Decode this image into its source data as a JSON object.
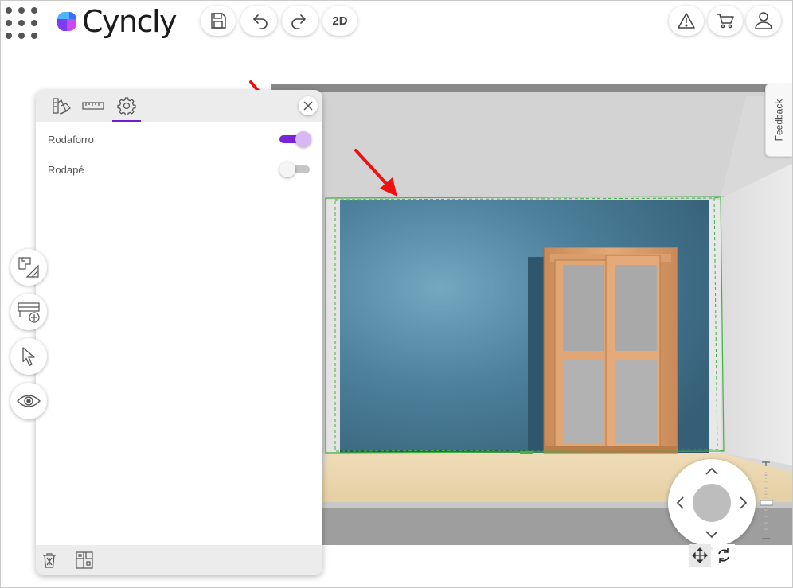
{
  "app": {
    "name": "Cyncly",
    "view_mode_label": "2D"
  },
  "header": {
    "left_buttons": [
      "save-icon",
      "undo-icon",
      "redo-icon"
    ],
    "right_buttons": [
      "warning-icon",
      "cart-icon",
      "user-icon"
    ]
  },
  "feedback_label": "Feedback",
  "panel": {
    "tabs": [
      {
        "icon": "color-palette-icon",
        "active": false
      },
      {
        "icon": "ruler-icon",
        "active": false
      },
      {
        "icon": "gear-icon",
        "active": true
      }
    ],
    "settings": [
      {
        "label": "Rodaforro",
        "enabled": true
      },
      {
        "label": "Rodapé",
        "enabled": false
      }
    ],
    "footer_buttons": [
      "trash-icon",
      "floorplan-icon"
    ]
  },
  "tools": [
    "floorplan-measure-icon",
    "add-furniture-icon",
    "pointer-icon",
    "eye-icon"
  ],
  "colors": {
    "accent": "#7b24d9",
    "wall": "#406f88",
    "floor": "#e9d5ac",
    "selection": "#43b043",
    "annotation_arrow": "#ee1111"
  }
}
